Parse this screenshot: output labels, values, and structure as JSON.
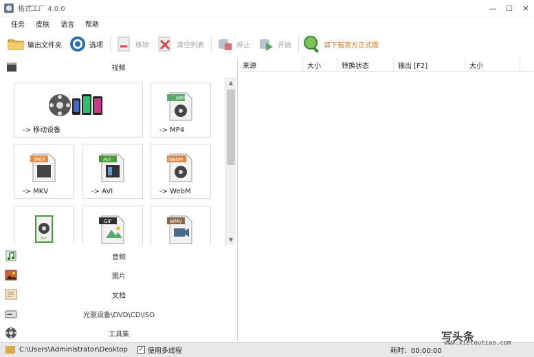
{
  "window": {
    "title": "格式工厂 4.0.0",
    "controls": {
      "minimize": "—",
      "maximize": "☐",
      "close": "✕"
    }
  },
  "menu": [
    "任务",
    "皮肤",
    "语言",
    "帮助"
  ],
  "toolbar": {
    "output_folder": "输出文件夹",
    "options": "选项",
    "remove": "移除",
    "clear_list": "清空列表",
    "stop": "停止",
    "start": "开始",
    "download_official": "请下载官方正式版"
  },
  "video_section": {
    "title": "视频",
    "tiles": [
      {
        "label": "-> 移动设备",
        "icon": "mobile-devices-icon"
      },
      {
        "label": "-> MP4",
        "badge": "MP4",
        "icon": "mp4-file-icon"
      },
      {
        "label": "-> MKV",
        "badge": "MKV",
        "icon": "mkv-file-icon"
      },
      {
        "label": "-> AVI",
        "badge": "AVI",
        "icon": "avi-file-icon"
      },
      {
        "label": "-> WebM",
        "badge": "WebM",
        "icon": "webm-file-icon"
      },
      {
        "label": "",
        "badge": "3GP",
        "icon": "3gp-file-icon"
      },
      {
        "label": "",
        "badge": "GIF",
        "icon": "gif-file-icon"
      },
      {
        "label": "",
        "badge": "WMV",
        "icon": "wmv-file-icon"
      }
    ]
  },
  "categories": [
    {
      "label": "音频",
      "icon": "audio-icon"
    },
    {
      "label": "图片",
      "icon": "picture-icon"
    },
    {
      "label": "文档",
      "icon": "document-icon"
    },
    {
      "label": "光驱设备\\DVD\\CD\\ISO",
      "icon": "optical-drive-icon"
    },
    {
      "label": "工具集",
      "icon": "toolbox-icon"
    }
  ],
  "table": {
    "columns": [
      "来源",
      "大小",
      "转换状态",
      "输出 [F2]",
      "大小"
    ]
  },
  "status": {
    "path": "C:\\Users\\Administrator\\Desktop",
    "multithread": "使用多线程",
    "time": "耗时：00:00:00"
  },
  "watermark": {
    "logo": "写头条",
    "url": "www.xietoutiao.com"
  },
  "colors": {
    "promo": "#e07a1c",
    "disabled": "#a0a0a0"
  }
}
